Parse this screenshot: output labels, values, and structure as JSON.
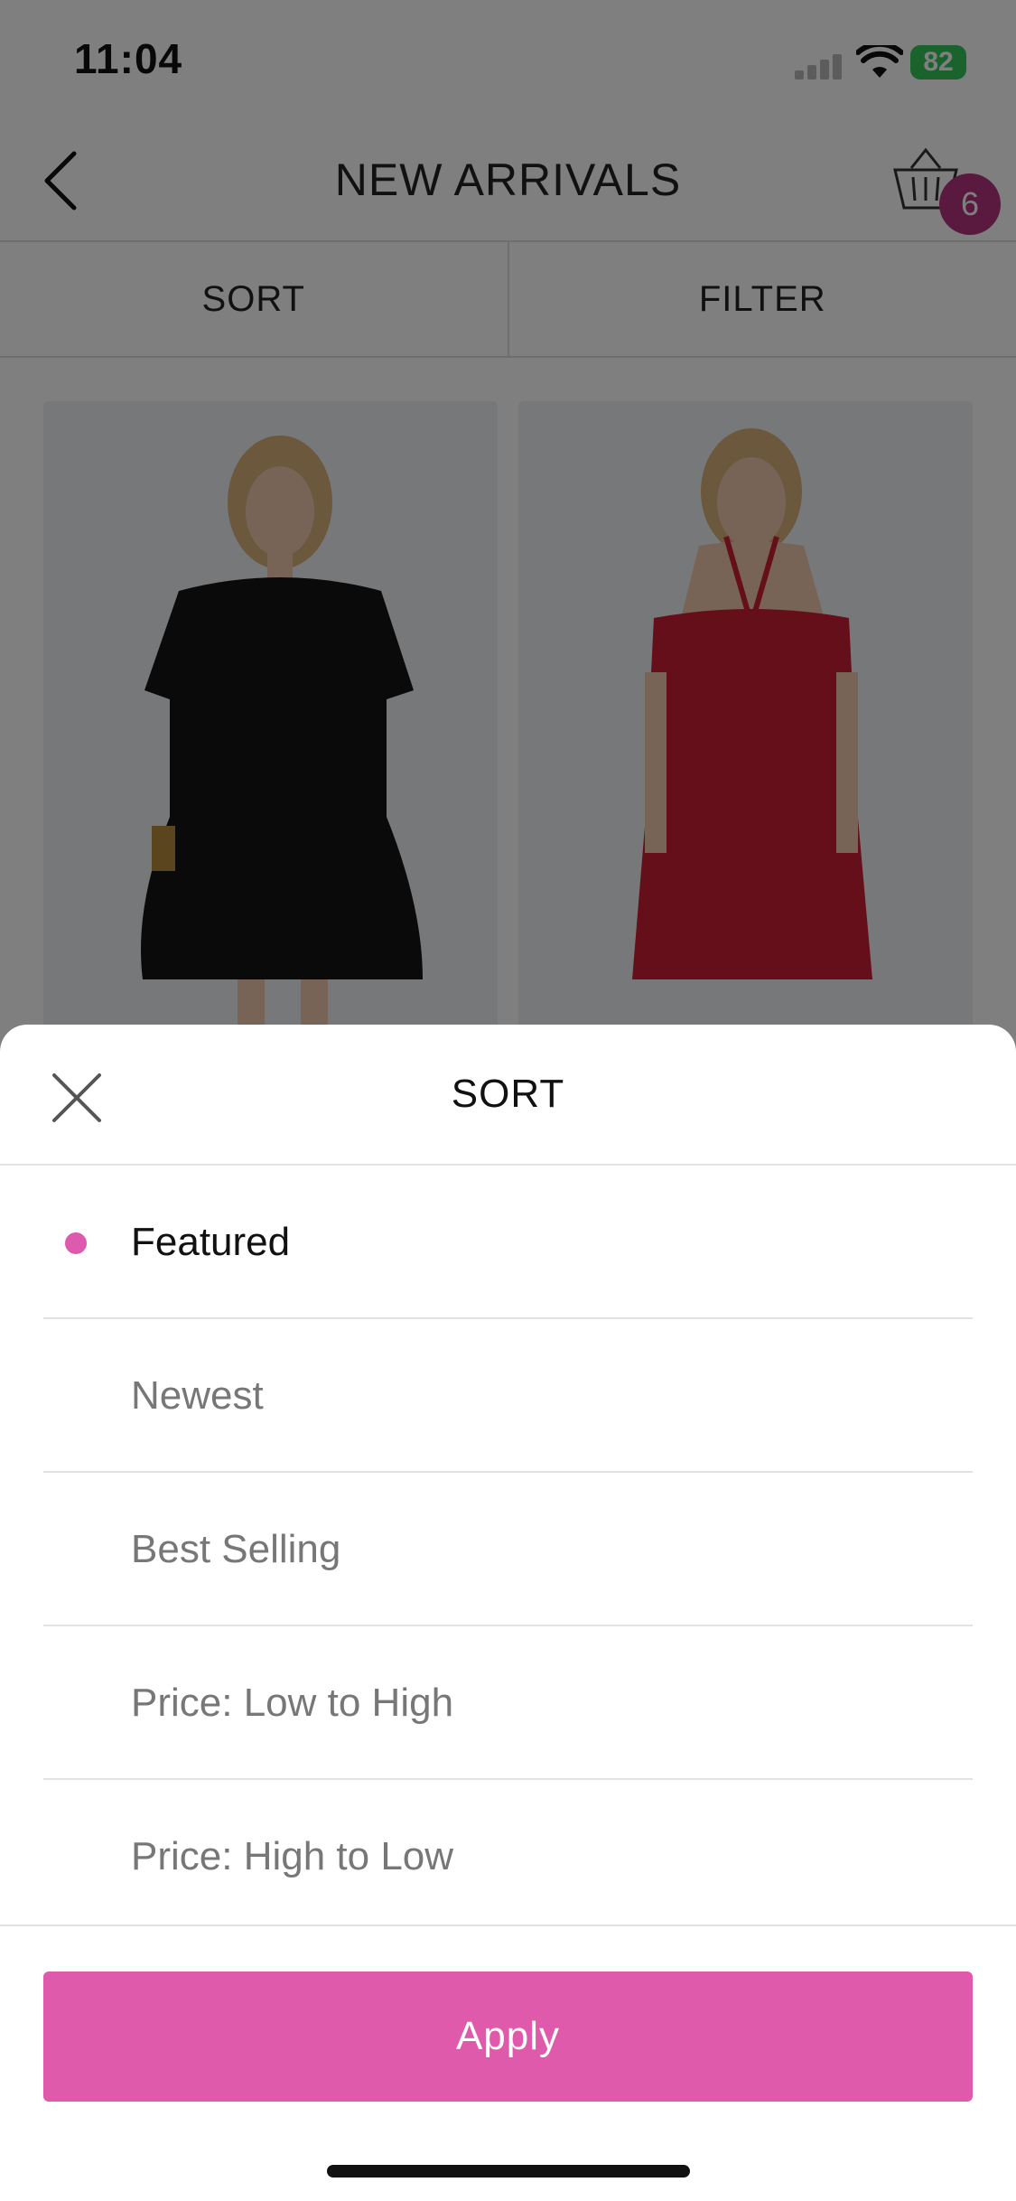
{
  "status_bar": {
    "time": "11:04",
    "battery": "82"
  },
  "header": {
    "title": "NEW ARRIVALS",
    "cart_count": "6"
  },
  "tabs": [
    {
      "label": "SORT"
    },
    {
      "label": "FILTER"
    }
  ],
  "products": [
    {
      "image": "black-ruffle-dress-photo"
    },
    {
      "image": "red-halter-romper-photo"
    }
  ],
  "sort_sheet": {
    "title": "SORT",
    "options": [
      {
        "label": "Featured",
        "selected": true
      },
      {
        "label": "Newest",
        "selected": false
      },
      {
        "label": "Best Selling",
        "selected": false
      },
      {
        "label": "Price: Low to High",
        "selected": false
      },
      {
        "label": "Price: High to Low",
        "selected": false
      }
    ],
    "apply_label": "Apply"
  },
  "colors": {
    "accent": "#e05aac",
    "selected_dot": "#de5aae",
    "badge": "#b4357e",
    "battery": "#34c759"
  }
}
